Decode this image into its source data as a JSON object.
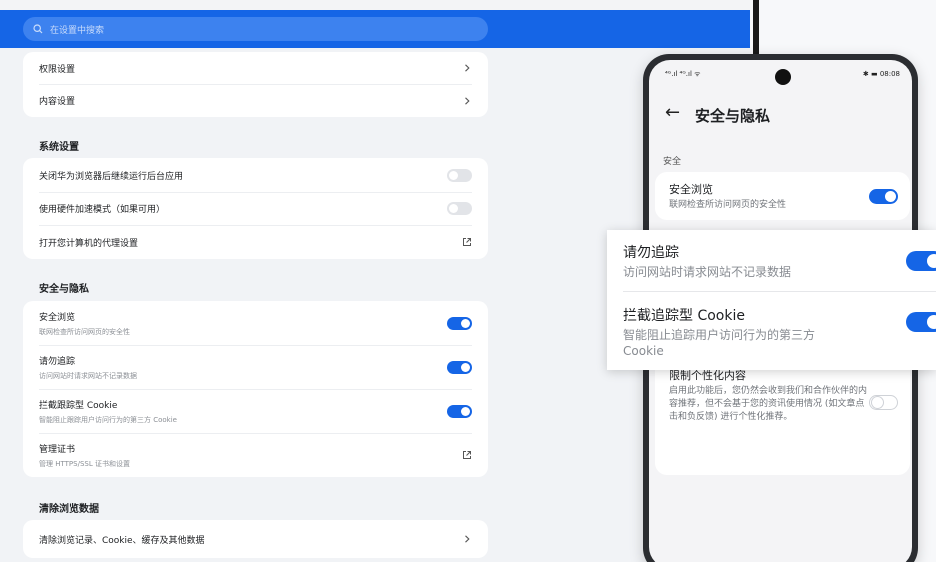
{
  "search": {
    "placeholder": "在设置中搜索"
  },
  "card_top": {
    "items": [
      {
        "label": "权限设置"
      },
      {
        "label": "内容设置"
      }
    ]
  },
  "system": {
    "title": "系统设置",
    "items": [
      {
        "label": "关闭华为浏览器后继续运行后台应用",
        "control": "toggle",
        "state": "off"
      },
      {
        "label": "使用硬件加速模式（如果可用）",
        "control": "toggle",
        "state": "off"
      },
      {
        "label": "打开您计算机的代理设置",
        "control": "external-link-icon"
      }
    ]
  },
  "privacy": {
    "title": "安全与隐私",
    "items": [
      {
        "label": "安全浏览",
        "sub": "联网检查所访问网页的安全性",
        "control": "toggle",
        "state": "on"
      },
      {
        "label": "请勿追踪",
        "sub": "访问网站时请求网站不记录数据",
        "control": "toggle",
        "state": "on"
      },
      {
        "label": "拦截跟踪型 Cookie",
        "sub": "智能阻止跟踪用户访问行为的第三方 Cookie",
        "control": "toggle",
        "state": "on"
      },
      {
        "label": "管理证书",
        "sub": "管理 HTTPS/SSL 证书和设置",
        "control": "external-link-icon"
      }
    ]
  },
  "clear": {
    "title": "清除浏览数据",
    "items": [
      {
        "label": "清除浏览记录、Cookie、缓存及其他数据"
      }
    ]
  },
  "phone": {
    "status_left": "⁴ᴳ.ıl ⁴ᴳ.ıl ᯤ",
    "status_right": "✱ ▬ 08:08",
    "title": "安全与隐私",
    "section": "安全",
    "safe_browsing": {
      "title": "安全浏览",
      "sub": "联网检查所访问网页的安全性"
    },
    "personalize": {
      "title": "限制个性化内容",
      "sub": "启用此功能后，您仍然会收到我们和合作伙伴的内容推荐，但不会基于您的资讯使用情况 (如文章点击和负反馈) 进行个性化推荐。"
    }
  },
  "callout": {
    "items": [
      {
        "title": "请勿追踪",
        "sub": "访问网站时请求网站不记录数据"
      },
      {
        "title": "拦截追踪型 Cookie",
        "sub": "智能阻止追踪用户访问行为的第三方 Cookie"
      }
    ]
  },
  "colors": {
    "accent": "#1565e6",
    "background": "#f1f3f6"
  }
}
